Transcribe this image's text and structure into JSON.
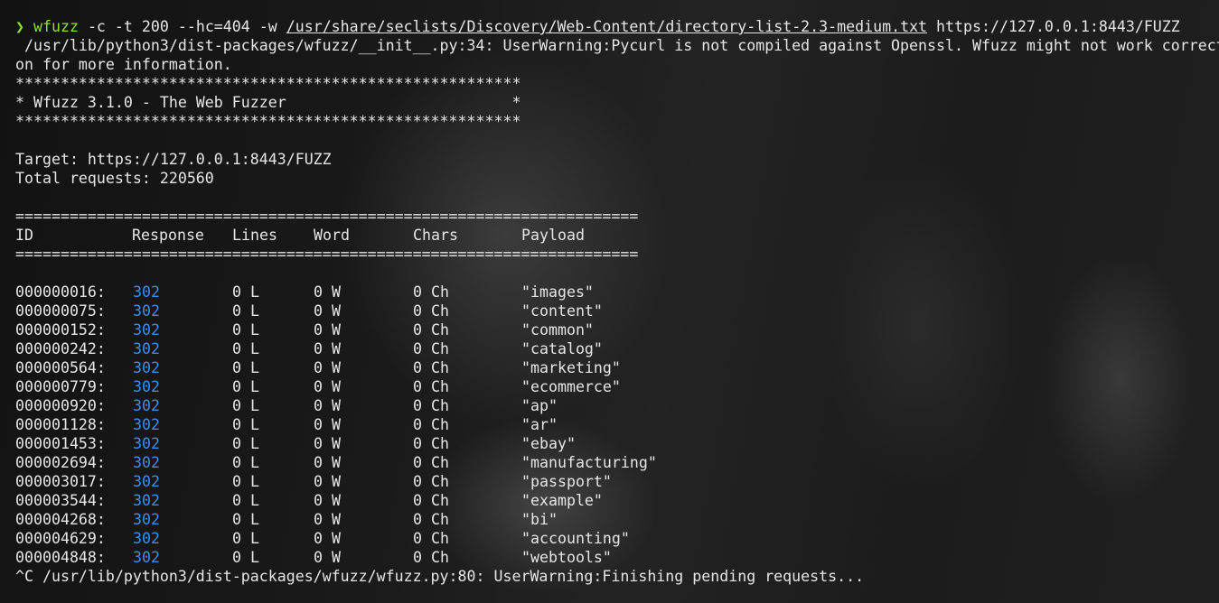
{
  "terminal": {
    "prompt_symbol": "❯",
    "command": {
      "program": "wfuzz",
      "args_before": " -c -t 200 --hc=404 -w ",
      "wordlist_path": "/usr/share/seclists/Discovery/Web-Content/directory-list-2.3-medium.txt",
      "args_after": " https://127.0.0.1:8443/FUZZ"
    },
    "warning_line_1": " /usr/lib/python3/dist-packages/wfuzz/__init__.py:34: UserWarning:Pycurl is not compiled against Openssl. Wfuzz might not work correct",
    "warning_line_2": "on for more information.",
    "banner_border": "********************************************************",
    "banner_title": "* Wfuzz 3.1.0 - The Web Fuzzer                         *",
    "target_line": "Target: https://127.0.0.1:8443/FUZZ",
    "total_requests_line": "Total requests: 220560",
    "separator": "=====================================================================",
    "columns": {
      "id": "ID",
      "response": "Response",
      "lines": "Lines",
      "word": "Word",
      "chars": "Chars",
      "payload": "Payload"
    },
    "results": [
      {
        "id": "000000016:",
        "response": "302",
        "lines": "0 L",
        "word": "0 W",
        "chars": "0 Ch",
        "payload": "\"images\""
      },
      {
        "id": "000000075:",
        "response": "302",
        "lines": "0 L",
        "word": "0 W",
        "chars": "0 Ch",
        "payload": "\"content\""
      },
      {
        "id": "000000152:",
        "response": "302",
        "lines": "0 L",
        "word": "0 W",
        "chars": "0 Ch",
        "payload": "\"common\""
      },
      {
        "id": "000000242:",
        "response": "302",
        "lines": "0 L",
        "word": "0 W",
        "chars": "0 Ch",
        "payload": "\"catalog\""
      },
      {
        "id": "000000564:",
        "response": "302",
        "lines": "0 L",
        "word": "0 W",
        "chars": "0 Ch",
        "payload": "\"marketing\""
      },
      {
        "id": "000000779:",
        "response": "302",
        "lines": "0 L",
        "word": "0 W",
        "chars": "0 Ch",
        "payload": "\"ecommerce\""
      },
      {
        "id": "000000920:",
        "response": "302",
        "lines": "0 L",
        "word": "0 W",
        "chars": "0 Ch",
        "payload": "\"ap\""
      },
      {
        "id": "000001128:",
        "response": "302",
        "lines": "0 L",
        "word": "0 W",
        "chars": "0 Ch",
        "payload": "\"ar\""
      },
      {
        "id": "000001453:",
        "response": "302",
        "lines": "0 L",
        "word": "0 W",
        "chars": "0 Ch",
        "payload": "\"ebay\""
      },
      {
        "id": "000002694:",
        "response": "302",
        "lines": "0 L",
        "word": "0 W",
        "chars": "0 Ch",
        "payload": "\"manufacturing\""
      },
      {
        "id": "000003017:",
        "response": "302",
        "lines": "0 L",
        "word": "0 W",
        "chars": "0 Ch",
        "payload": "\"passport\""
      },
      {
        "id": "000003544:",
        "response": "302",
        "lines": "0 L",
        "word": "0 W",
        "chars": "0 Ch",
        "payload": "\"example\""
      },
      {
        "id": "000004268:",
        "response": "302",
        "lines": "0 L",
        "word": "0 W",
        "chars": "0 Ch",
        "payload": "\"bi\""
      },
      {
        "id": "000004629:",
        "response": "302",
        "lines": "0 L",
        "word": "0 W",
        "chars": "0 Ch",
        "payload": "\"accounting\""
      },
      {
        "id": "000004848:",
        "response": "302",
        "lines": "0 L",
        "word": "0 W",
        "chars": "0 Ch",
        "payload": "\"webtools\""
      }
    ],
    "final_line": "^C /usr/lib/python3/dist-packages/wfuzz/wfuzz.py:80: UserWarning:Finishing pending requests..."
  },
  "colors": {
    "prompt_green": "#8ae234",
    "status_blue": "#3b8eea",
    "text": "#e6e6e6"
  }
}
